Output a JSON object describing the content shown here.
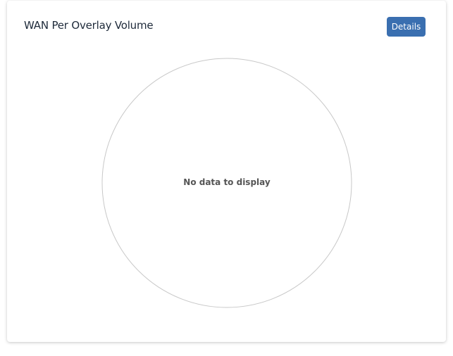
{
  "card": {
    "title": "WAN Per Overlay Volume",
    "details_label": "Details"
  },
  "colors": {
    "button_bg": "#3a6fb0",
    "circle_stroke": "#c8c8c8",
    "no_data_text": "#555555"
  },
  "chart_data": {
    "type": "pie",
    "title": "WAN Per Overlay Volume",
    "series": [],
    "empty_message": "No data to display"
  }
}
